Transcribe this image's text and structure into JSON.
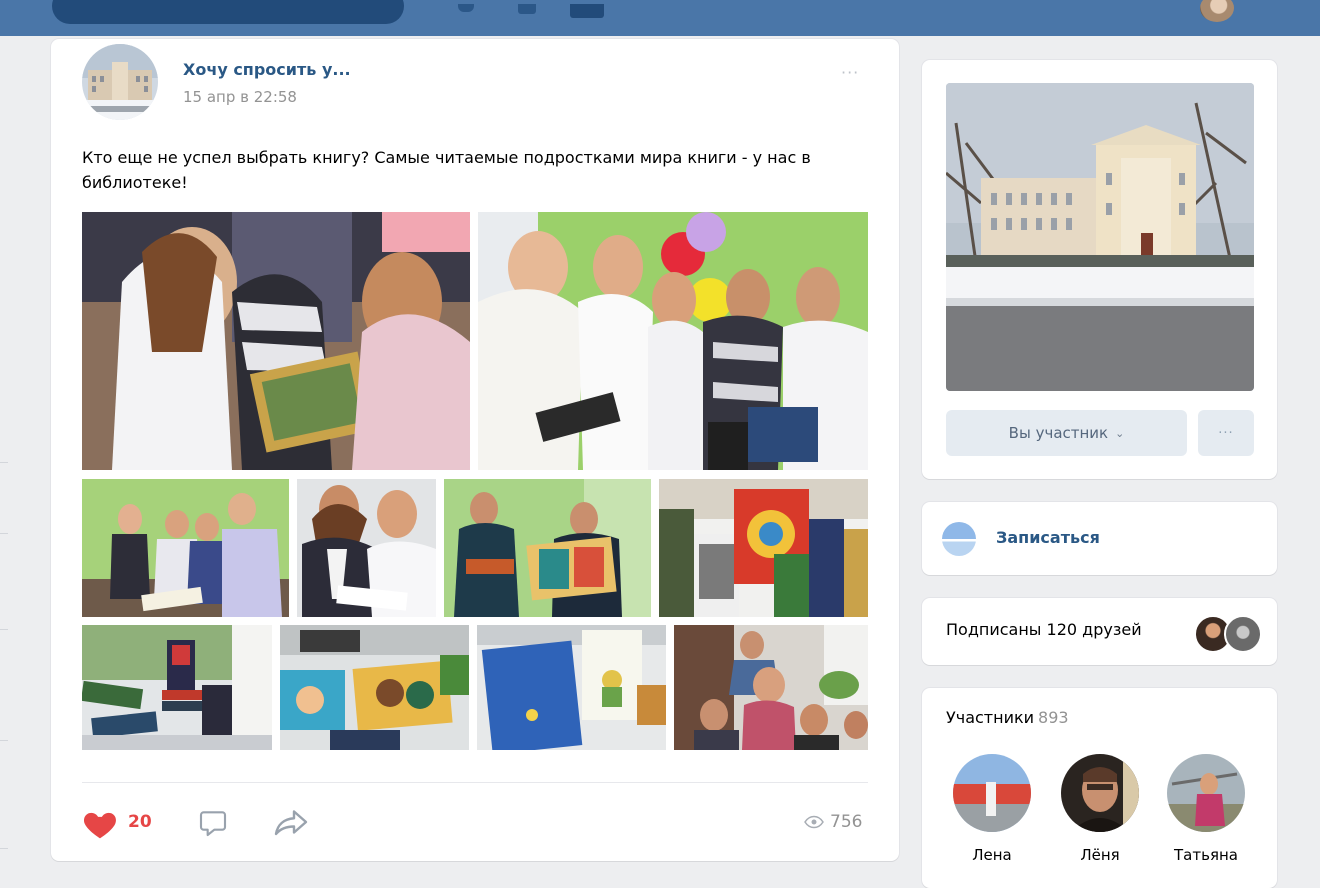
{
  "post": {
    "author": "Хочу спросить у...",
    "date": "15 апр в 22:58",
    "more": "···",
    "text": "Кто еще не успел выбрать книгу? Самые читаемые подростками мира книги - у нас в библиотеке!",
    "likes": "20",
    "views": "756",
    "photo_count": 10
  },
  "group": {
    "member_button": "Вы участник",
    "member_button_chevron": "⌄",
    "more_button": "···"
  },
  "signup": {
    "label": "Записаться"
  },
  "friends": {
    "label": "Подписаны 120 друзей"
  },
  "members": {
    "title": "Участники",
    "count": "893",
    "items": [
      {
        "name": "Лена"
      },
      {
        "name": "Лёня"
      },
      {
        "name": "Татьяна"
      }
    ]
  },
  "colors": {
    "accent": "#4a76a8",
    "link": "#2a5885",
    "like": "#e64646",
    "muted": "#939393",
    "button_bg": "#e5ebf1"
  },
  "icons": [
    "heart-icon",
    "comment-icon",
    "share-icon",
    "eye-icon",
    "more-dots-icon",
    "calendar-icon"
  ]
}
